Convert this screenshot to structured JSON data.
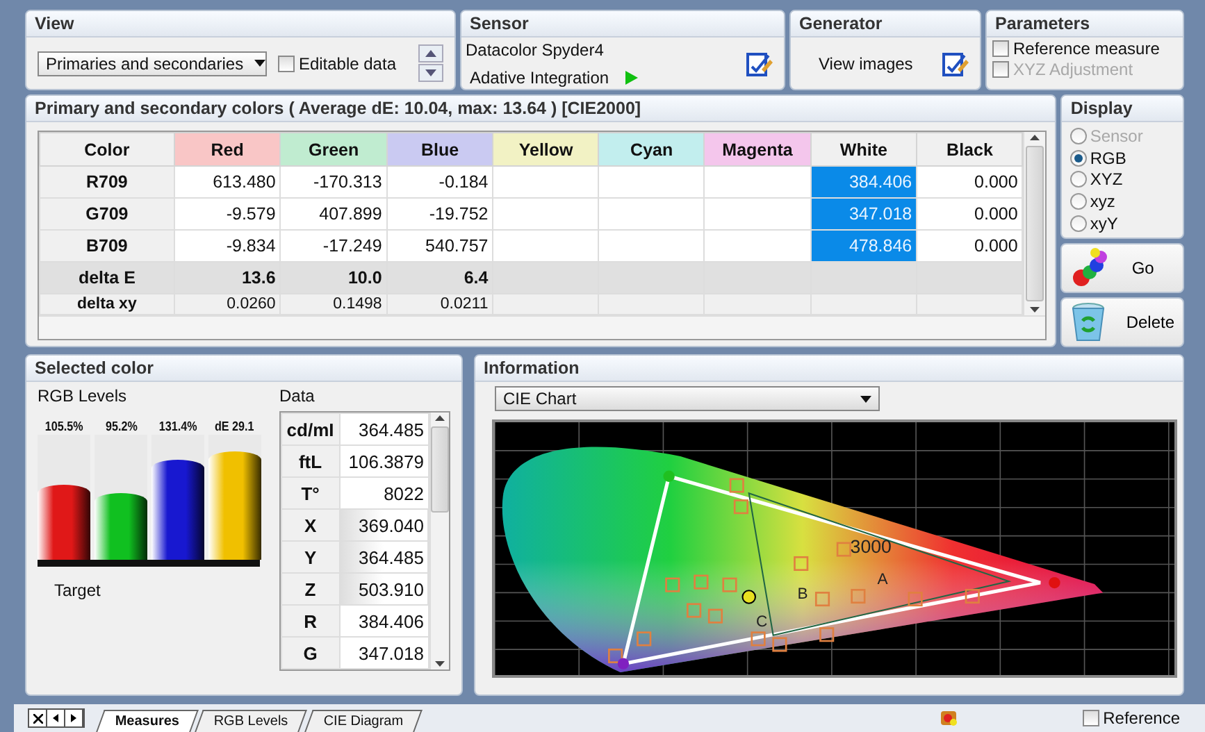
{
  "view": {
    "title": "View",
    "dropdown": "Primaries and secondaries",
    "editable": {
      "label": "Editable data",
      "checked": false
    }
  },
  "sensor": {
    "title": "Sensor",
    "name": "Datacolor Spyder4",
    "mode": "Adative Integration"
  },
  "generator": {
    "title": "Generator",
    "button": "View images"
  },
  "parameters": {
    "title": "Parameters",
    "options": [
      {
        "label": "Reference measure",
        "checked": false,
        "disabled": false
      },
      {
        "label": "XYZ Adjustment",
        "checked": false,
        "disabled": true
      }
    ]
  },
  "colors_table": {
    "title": "Primary and secondary colors ( Average dE: 10.04, max: 13.64 ) [CIE2000]",
    "corner": "Color",
    "columns": [
      {
        "label": "Red",
        "color": "#f9c6c6"
      },
      {
        "label": "Green",
        "color": "#c0ecd0"
      },
      {
        "label": "Blue",
        "color": "#cacaf2"
      },
      {
        "label": "Yellow",
        "color": "#f2f2c4"
      },
      {
        "label": "Cyan",
        "color": "#c2eeee"
      },
      {
        "label": "Magenta",
        "color": "#f4c6ec"
      },
      {
        "label": "White",
        "color": "#f0f0f0"
      },
      {
        "label": "Black",
        "color": "#f0f0f0"
      }
    ],
    "rows": [
      {
        "label": "R709",
        "kind": "value",
        "cells": [
          {
            "text": "613.480",
            "selected": false
          },
          {
            "text": "-170.313",
            "selected": false
          },
          {
            "text": "-0.184",
            "selected": false
          },
          {
            "selected": false
          },
          {
            "selected": false
          },
          {
            "selected": false
          },
          {
            "text": "384.406",
            "selected": true
          },
          {
            "text": "0.000",
            "selected": false
          }
        ]
      },
      {
        "label": "G709",
        "kind": "value",
        "cells": [
          {
            "text": "-9.579",
            "selected": false
          },
          {
            "text": "407.899",
            "selected": false
          },
          {
            "text": "-19.752",
            "selected": false
          },
          {
            "selected": false
          },
          {
            "selected": false
          },
          {
            "selected": false
          },
          {
            "text": "347.018",
            "selected": true
          },
          {
            "text": "0.000",
            "selected": false
          }
        ]
      },
      {
        "label": "B709",
        "kind": "value",
        "cells": [
          {
            "text": "-9.834",
            "selected": false
          },
          {
            "text": "-17.249",
            "selected": false
          },
          {
            "text": "540.757",
            "selected": false
          },
          {
            "selected": false
          },
          {
            "selected": false
          },
          {
            "selected": false
          },
          {
            "text": "478.846",
            "selected": true
          },
          {
            "text": "0.000",
            "selected": false
          }
        ]
      },
      {
        "label": "delta E",
        "kind": "summary",
        "cells": [
          {
            "text": "13.6",
            "selected": false
          },
          {
            "text": "10.0",
            "selected": false
          },
          {
            "text": "6.4",
            "selected": false
          },
          {
            "selected": false
          },
          {
            "selected": false
          },
          {
            "selected": false
          },
          {
            "selected": false
          },
          {
            "selected": false
          }
        ]
      },
      {
        "label": "delta xy",
        "kind": "detail",
        "cells": [
          {
            "text": "0.0260",
            "selected": false
          },
          {
            "text": "0.1498",
            "selected": false
          },
          {
            "text": "0.0211",
            "selected": false
          },
          {
            "selected": false
          },
          {
            "selected": false
          },
          {
            "selected": false
          },
          {
            "selected": false
          },
          {
            "selected": false
          }
        ]
      }
    ]
  },
  "display": {
    "title": "Display",
    "options": [
      {
        "label": "Sensor",
        "selected": false,
        "disabled": true
      },
      {
        "label": "RGB",
        "selected": true,
        "disabled": false
      },
      {
        "label": "XYZ",
        "selected": false,
        "disabled": false
      },
      {
        "label": "xyz",
        "selected": false,
        "disabled": false
      },
      {
        "label": "xyY",
        "selected": false,
        "disabled": false
      }
    ]
  },
  "actions": [
    {
      "label": "Go",
      "kind": "go"
    },
    {
      "label": "Delete",
      "kind": "delete"
    }
  ],
  "selected_color": {
    "title": "Selected color",
    "levels_label": "RGB Levels",
    "data_label": "Data",
    "target_label": "Target",
    "bars": [
      {
        "label": "105.5%",
        "color": "#e01818",
        "level": 0.6
      },
      {
        "label": "95.2%",
        "color": "#10c020",
        "level": 0.53
      },
      {
        "label": "131.4%",
        "color": "#1818d0",
        "level": 0.8
      },
      {
        "label": "dE 29.1",
        "color": "#f0c000",
        "level": 0.87
      }
    ],
    "data_rows": [
      {
        "label": "cd/mI",
        "value": "364.485",
        "kind": "plain"
      },
      {
        "label": "ftL",
        "value": "106.3879",
        "kind": "plain"
      },
      {
        "label": "T°",
        "value": "8022",
        "kind": "plain"
      },
      {
        "label": "X",
        "value": "369.040",
        "kind": "shaded"
      },
      {
        "label": "Y",
        "value": "364.485",
        "kind": "shaded"
      },
      {
        "label": "Z",
        "value": "503.910",
        "kind": "shaded"
      },
      {
        "label": "R",
        "value": "384.406",
        "kind": "plain"
      },
      {
        "label": "G",
        "value": "347.018",
        "kind": "plain"
      }
    ]
  },
  "information": {
    "title": "Information",
    "dropdown": "CIE Chart",
    "chart_labels": [
      "3000",
      "A",
      "B",
      "C"
    ]
  },
  "tabs": [
    {
      "label": "Measures",
      "selected": true
    },
    {
      "label": "RGB Levels",
      "selected": false
    },
    {
      "label": "CIE Diagram",
      "selected": false
    }
  ],
  "status_bar": {
    "reference": {
      "label": "Reference",
      "checked": false
    }
  }
}
